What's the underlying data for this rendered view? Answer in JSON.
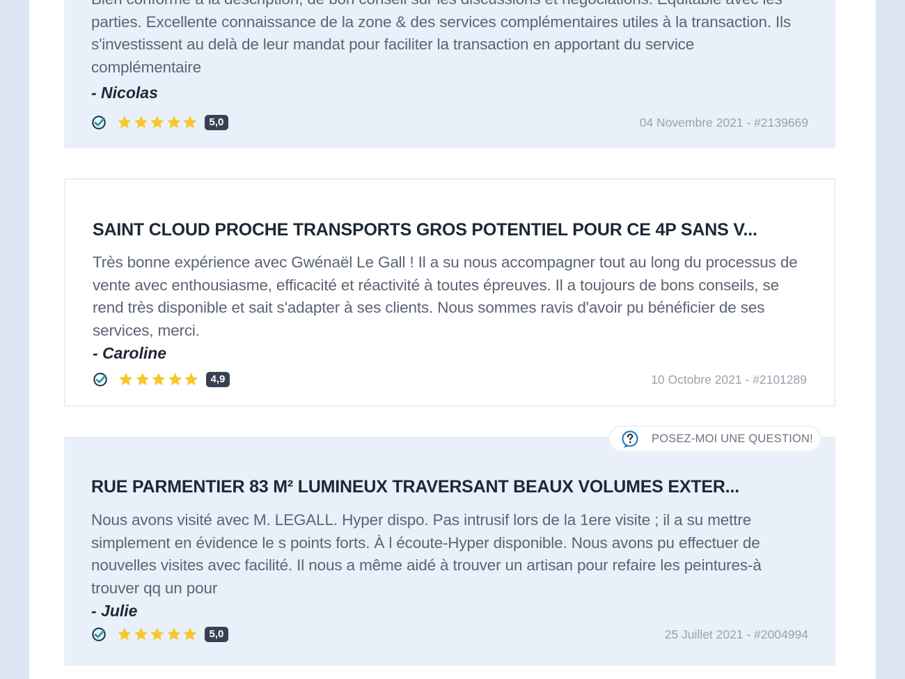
{
  "reviews": [
    {
      "title": "",
      "text": "Bien conforme à la description, de bon conseil sur les discussions et négociations. Equitable avec les parties. Excellente connaissance de la zone & des services complémentaires utiles à la transaction. Ils s'investissent au delà de leur mandat pour faciliter la transaction en apportant du service complémentaire",
      "author": "- Nicolas",
      "score": "5,0",
      "meta": "04 Novembre 2021 - #2139669"
    },
    {
      "title": "SAINT CLOUD PROCHE TRANSPORTS GROS POTENTIEL POUR CE 4P SANS V...",
      "text": "Très bonne expérience avec Gwénaël Le Gall ! Il a su nous accompagner tout au long du processus de vente avec enthousiasme, efficacité et réactivité à toutes épreuves. Il a toujours de bons conseils, se rend très disponible et sait s'adapter à ses clients. Nous sommes ravis d'avoir pu bénéficier de ses services, merci.",
      "author": "- Caroline",
      "score": "4,9",
      "meta": "10 Octobre 2021 - #2101289"
    },
    {
      "title": "RUE PARMENTIER 83 M² LUMINEUX TRAVERSANT BEAUX VOLUMES EXTER...",
      "text": "Nous avons visité avec M. LEGALL. Hyper dispo. Pas intrusif lors de la 1ere visite ; il a su mettre simplement en évidence le s points forts. À l écoute-Hyper disponible. Nous avons pu effectuer de nouvelles visites avec facilité. Il nous a même aidé à trouver un artisan pour refaire les peintures-à trouver qq un pour",
      "author": "- Julie",
      "score": "5,0",
      "meta": "25 Juillet 2021 - #2004994"
    }
  ],
  "ask_button": {
    "label": "POSEZ-MOI UNE QUESTION!"
  },
  "icons": {
    "verified": "verified-check-icon",
    "star": "star-icon",
    "question": "question-bubble-icon"
  },
  "colors": {
    "star": "#f9c62a",
    "check": "#1f9aa8",
    "score_bg": "#374153",
    "question": "#2b7fc4"
  }
}
